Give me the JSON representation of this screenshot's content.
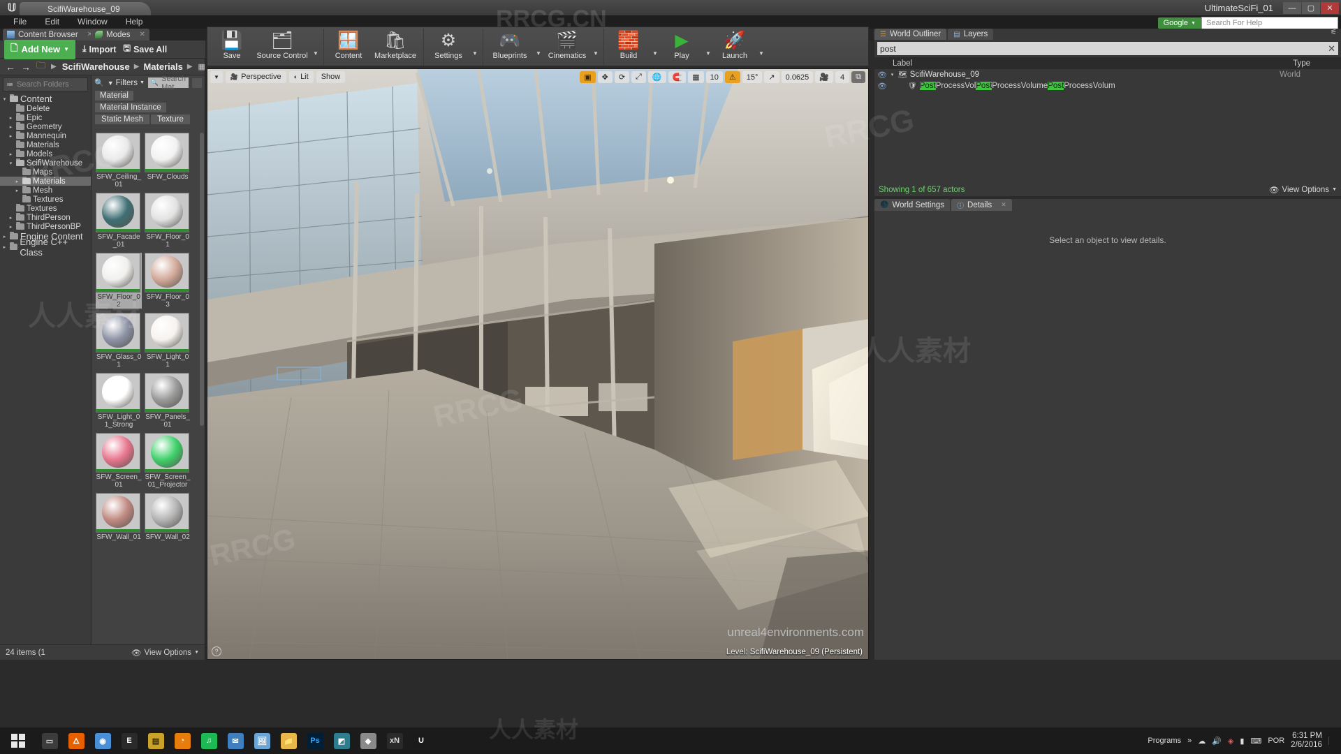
{
  "titlebar": {
    "tab_label": "ScifiWarehouse_09",
    "app_title": "UltimateSciFi_01",
    "minimize": "—",
    "maximize": "▢",
    "close": "✕",
    "logo_icon": "unreal-logo-icon"
  },
  "menubar": {
    "items": [
      "File",
      "Edit",
      "Window",
      "Help"
    ]
  },
  "google_search": {
    "selector": "Google",
    "placeholder": "Search For Help",
    "value": ""
  },
  "panel_tabs": [
    {
      "label": "Content Browser",
      "icon": "grid-icon",
      "close": "✕"
    },
    {
      "label": "Modes",
      "icon": "modes-icon",
      "close": "✕"
    }
  ],
  "toolbar": {
    "groups": [
      {
        "buttons": [
          {
            "label": "Save",
            "icon": "save-icon",
            "arrow": false
          },
          {
            "label": "Source Control",
            "icon": "source-control-icon",
            "arrow": true
          }
        ]
      },
      {
        "buttons": [
          {
            "label": "Content",
            "icon": "content-icon",
            "arrow": false
          },
          {
            "label": "Marketplace",
            "icon": "marketplace-icon",
            "arrow": false
          }
        ]
      },
      {
        "buttons": [
          {
            "label": "Settings",
            "icon": "settings-gear-icon",
            "arrow": true
          }
        ]
      },
      {
        "buttons": [
          {
            "label": "Blueprints",
            "icon": "blueprints-icon",
            "arrow": true
          },
          {
            "label": "Cinematics",
            "icon": "cinematics-clapper-icon",
            "arrow": true
          }
        ]
      },
      {
        "buttons": [
          {
            "label": "Build",
            "icon": "build-icon",
            "arrow": true
          },
          {
            "label": "Play",
            "icon": "play-icon",
            "arrow": true
          },
          {
            "label": "Launch",
            "icon": "launch-rocket-icon",
            "arrow": true
          }
        ]
      }
    ]
  },
  "content_browser": {
    "nav": {
      "back": "←",
      "forward": "→",
      "folder_icon": "folder-icon",
      "sep": "▶"
    },
    "breadcrumbs": [
      "ScifiWarehouse",
      "Materials"
    ],
    "breadcrumb_more": "▶",
    "folder_search_placeholder": "Search Folders",
    "add_new_label": "Add New",
    "import_label": "Import",
    "save_all_label": "Save All",
    "folder_tree": [
      {
        "label": "Content",
        "indent": 0,
        "tri": "▾",
        "size": "big",
        "open": true
      },
      {
        "label": "Delete",
        "indent": 1,
        "tri": "",
        "size": "sm"
      },
      {
        "label": "Epic",
        "indent": 1,
        "tri": "▸",
        "size": "sm"
      },
      {
        "label": "Geometry",
        "indent": 1,
        "tri": "▸",
        "size": "sm"
      },
      {
        "label": "Mannequin",
        "indent": 1,
        "tri": "▸",
        "size": "sm"
      },
      {
        "label": "Materials",
        "indent": 1,
        "tri": "",
        "size": "sm"
      },
      {
        "label": "Models",
        "indent": 1,
        "tri": "▸",
        "size": "sm"
      },
      {
        "label": "ScifiWarehouse",
        "indent": 1,
        "tri": "▾",
        "size": "sm",
        "open": true
      },
      {
        "label": "Maps",
        "indent": 2,
        "tri": "",
        "size": "sm"
      },
      {
        "label": "Materials",
        "indent": 2,
        "tri": "▸",
        "size": "sm",
        "selected": true
      },
      {
        "label": "Mesh",
        "indent": 2,
        "tri": "▸",
        "size": "sm"
      },
      {
        "label": "Textures",
        "indent": 2,
        "tri": "",
        "size": "sm"
      },
      {
        "label": "Textures",
        "indent": 1,
        "tri": "",
        "size": "sm"
      },
      {
        "label": "ThirdPerson",
        "indent": 1,
        "tri": "▸",
        "size": "sm"
      },
      {
        "label": "ThirdPersonBP",
        "indent": 1,
        "tri": "▸",
        "size": "sm"
      },
      {
        "label": "Engine Content",
        "indent": 0,
        "tri": "▸",
        "size": "big"
      },
      {
        "label": "Engine C++ Class",
        "indent": 0,
        "tri": "▸",
        "size": "big"
      }
    ],
    "filters_label": "Filters",
    "asset_search_placeholder": "Search Mat",
    "filter_chips": [
      "Material",
      "Material Instance",
      "Static Mesh",
      "Texture"
    ],
    "assets": [
      {
        "name": "SFW_Ceiling_01",
        "color": "#e9e9ea"
      },
      {
        "name": "SFW_Clouds",
        "color": "#f2f2f2"
      },
      {
        "name": "SFW_Facade_01",
        "color": "#3f6f74"
      },
      {
        "name": "SFW_Floor_01",
        "color": "#e2e2e2"
      },
      {
        "name": "SFW_Floor_02",
        "color": "#f0f0ee",
        "selected": true
      },
      {
        "name": "SFW_Floor_03",
        "color": "#d2a99a"
      },
      {
        "name": "SFW_Glass_01",
        "color": "#8d93a6"
      },
      {
        "name": "SFW_Light_01",
        "color": "#f6f2ef"
      },
      {
        "name": "SFW_Light_01_Strong",
        "color": "#ffffff"
      },
      {
        "name": "SFW_Panels_01",
        "color": "#9a9a9a"
      },
      {
        "name": "SFW_Screen_01",
        "color": "#e8758e"
      },
      {
        "name": "SFW_Screen_01_Projector",
        "color": "#3fd06a"
      },
      {
        "name": "SFW_Wall_01",
        "color": "#c08a82"
      },
      {
        "name": "SFW_Wall_02",
        "color": "#b4b4b4"
      }
    ],
    "footer": {
      "item_count": "24 items (1",
      "view_options": "View Options",
      "eye_icon": "eye-icon"
    }
  },
  "viewport": {
    "perspective_label": "Perspective",
    "lit_label": "Lit",
    "show_label": "Show",
    "right_controls": [
      {
        "name": "camera-speed-icon",
        "label": "",
        "icon": "camera-icon"
      },
      {
        "name": "translate-icon",
        "label": "",
        "icon": "move-icon"
      },
      {
        "name": "rotate-icon",
        "label": "",
        "icon": "rotate-icon"
      },
      {
        "name": "scale-icon",
        "label": "",
        "icon": "scale-icon"
      },
      {
        "name": "world-coords-icon",
        "label": "",
        "icon": "globe-icon"
      },
      {
        "name": "surface-snap-icon",
        "label": "",
        "icon": "magnet-icon"
      },
      {
        "name": "grid-snap-icon",
        "label": "",
        "icon": "grid-icon"
      }
    ],
    "grid_snap_value": "10",
    "angle_snap_value": "15°",
    "scale_snap_value": "0.0625",
    "camera_speed_value": "4",
    "level_prefix": "Level:",
    "level_name": "ScifiWarehouse_09 (Persistent)",
    "watermark_site": "unreal4environments.com",
    "corner_icon": "help-icon"
  },
  "outliner": {
    "tabs": [
      {
        "label": "World Outliner",
        "active": true,
        "icon": "outliner-icon"
      },
      {
        "label": "Layers",
        "active": false,
        "icon": "layers-icon"
      }
    ],
    "search_value": "post",
    "search_clear": "✕",
    "columns": {
      "label": "Label",
      "type": "Type",
      "sort": "▲"
    },
    "rows": [
      {
        "label": "ScifiWarehouse_09",
        "type": "World",
        "indent": 0,
        "tri": "▾",
        "icon": "world-icon",
        "eye": "eye-icon",
        "highlight": []
      },
      {
        "label_parts": [
          {
            "t": "Post",
            "hl": true
          },
          {
            "t": "ProcessVol",
            "hl": false
          },
          {
            "t": "Post",
            "hl": true
          },
          {
            "t": "ProcessVolume",
            "hl": false
          },
          {
            "t": "Post",
            "hl": true
          },
          {
            "t": "ProcessVolum",
            "hl": false
          }
        ],
        "type": "",
        "indent": 1,
        "tri": "",
        "icon": "volume-icon",
        "eye": "eye-icon"
      }
    ],
    "footer_count": "Showing 1 of 657 actors",
    "view_options": "View Options"
  },
  "details": {
    "tabs": [
      {
        "label": "World Settings",
        "active": false,
        "icon": "world-settings-icon"
      },
      {
        "label": "Details",
        "active": true,
        "icon": "details-info-icon",
        "close": "✕"
      }
    ],
    "empty_text": "Select an object to view details."
  },
  "taskbar": {
    "start_icon": "windows-start-icon",
    "apps": [
      {
        "name": "task-view-icon",
        "glyph": "▭",
        "bg": "#3c3c3c",
        "fg": "#cfcfcf"
      },
      {
        "name": "firefox-icon",
        "glyph": "🜂",
        "bg": "#e66000",
        "fg": "#ffffff"
      },
      {
        "name": "chrome-icon",
        "glyph": "◉",
        "bg": "#4a90d9",
        "fg": "#ffffff"
      },
      {
        "name": "epic-games-icon",
        "glyph": "E",
        "bg": "#2a2a2a",
        "fg": "#ffffff"
      },
      {
        "name": "notes-icon",
        "glyph": "▤",
        "bg": "#c9a227",
        "fg": "#3a2c00"
      },
      {
        "name": "blender-icon",
        "glyph": "◔",
        "bg": "#e87d0d",
        "fg": "#ffffff"
      },
      {
        "name": "spotify-icon",
        "glyph": "♫",
        "bg": "#1db954",
        "fg": "#ffffff"
      },
      {
        "name": "mail-icon",
        "glyph": "✉",
        "bg": "#3f7fbf",
        "fg": "#ffffff"
      },
      {
        "name": "photos-icon",
        "glyph": "🖼",
        "bg": "#6aa5d6",
        "fg": "#ffffff"
      },
      {
        "name": "explorer-icon",
        "glyph": "📁",
        "bg": "#e8b84b",
        "fg": "#5a4000"
      },
      {
        "name": "photoshop-icon",
        "glyph": "Ps",
        "bg": "#001e36",
        "fg": "#31a8ff"
      },
      {
        "name": "3dsmax-icon",
        "glyph": "◩",
        "bg": "#2e7d8f",
        "fg": "#ffffff"
      },
      {
        "name": "substance-icon",
        "glyph": "◆",
        "bg": "#8a8a8a",
        "fg": "#ffffff"
      },
      {
        "name": "xnormal-icon",
        "glyph": "xN",
        "bg": "#2a2a2a",
        "fg": "#dcdcdc"
      },
      {
        "name": "unreal-icon",
        "glyph": "U",
        "bg": "#1a1a1a",
        "fg": "#ffffff"
      }
    ],
    "programs_label": "Programs",
    "programs_chevron": "»",
    "tray": [
      {
        "name": "onedrive-tray-icon",
        "glyph": "☁"
      },
      {
        "name": "volume-tray-icon",
        "glyph": "🔊"
      },
      {
        "name": "antivirus-tray-icon",
        "glyph": "◈"
      },
      {
        "name": "network-tray-icon",
        "glyph": "▮"
      },
      {
        "name": "keyboard-tray-icon",
        "glyph": "⌨"
      }
    ],
    "language": "POR",
    "time": "6:31 PM",
    "date": "2/6/2016"
  },
  "watermarks": {
    "top": "RRCG.CN",
    "marks": [
      "RRCG",
      "人人素材",
      "RRCG",
      "人人素材",
      "RRCG",
      "人人素材",
      "RRCG"
    ]
  },
  "colors": {
    "accent_green": "#3fa03f",
    "orange": "#e8a020",
    "panel_bg": "#383838",
    "dark_bg": "#2b2b2b"
  }
}
